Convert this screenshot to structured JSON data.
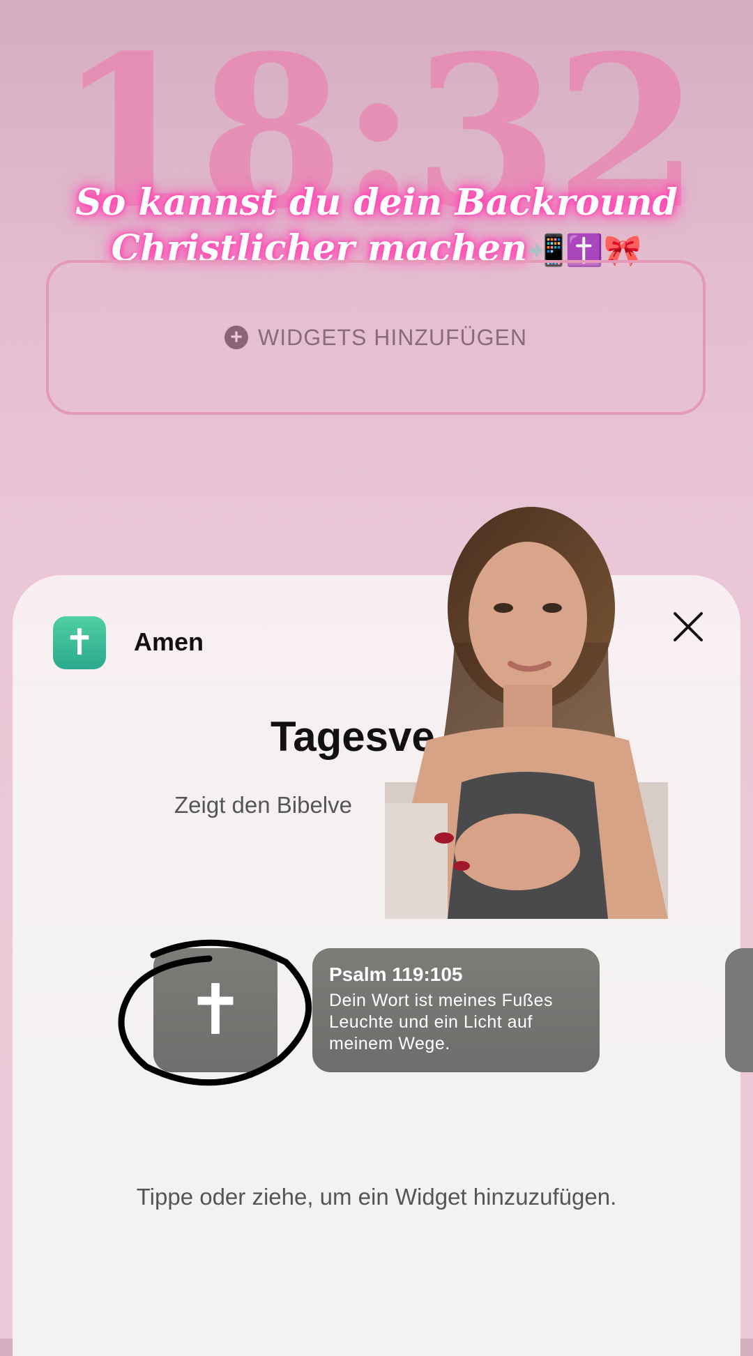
{
  "lockscreen": {
    "time": "18:32",
    "caption_line1": "So kannst du dein Backround",
    "caption_line2": "Christlicher machen",
    "caption_emoji": "📲✝️🎀",
    "add_widgets_label": "WIDGETS HINZUFÜGEN"
  },
  "sheet": {
    "app_name": "Amen",
    "widget_title": "Tagesve",
    "widget_description": "Zeigt den Bibelve",
    "verse_ref": "Psalm 119:105",
    "verse_text": "Dein Wort ist meines Fußes Leuchte und ein Licht auf meinem Wege.",
    "hint": "Tippe oder ziehe, um ein Widget hinzuzufügen."
  },
  "colors": {
    "accent_pink": "#e98ab5",
    "glow": "#ff3fae",
    "app_green": "#3cc09a"
  },
  "icons": [
    "plus-circle-icon",
    "cross-icon",
    "close-icon"
  ]
}
